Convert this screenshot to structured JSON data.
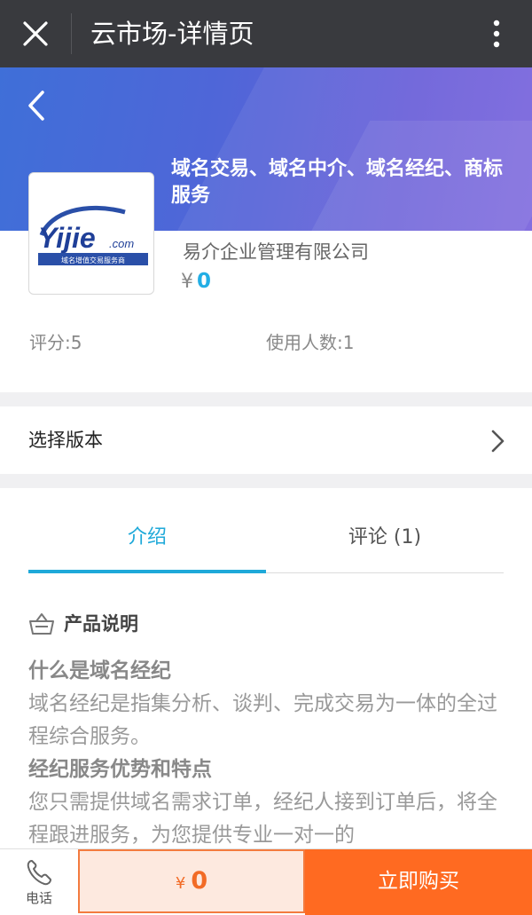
{
  "topbar": {
    "title": "云市场-详情页"
  },
  "product": {
    "name": "域名交易、域名中介、域名经纪、商标服务",
    "company": "易介企业管理有限公司",
    "currency": "¥",
    "price": "0",
    "logo_text": "Yijie.com",
    "logo_tagline": "域名增值交易服务商"
  },
  "stats": {
    "score": "评分:5",
    "users": "使用人数:1"
  },
  "version": {
    "label": "选择版本"
  },
  "tabs": [
    {
      "label": "介绍"
    },
    {
      "label": "评论 (1)"
    }
  ],
  "section": {
    "title": "产品说明"
  },
  "article": {
    "heading1": "什么是域名经纪",
    "para1": "域名经纪是指集分析、谈判、完成交易为一体的全过程综合服务。",
    "heading2": "经纪服务优势和特点",
    "para2": "您只需提供域名需求订单，经纪人接到订单后，将全程跟进服务，为您提供专业一对一的"
  },
  "bottom": {
    "phone_label": "电话",
    "currency": "¥",
    "price": "0",
    "buy_label": "立即购买"
  },
  "colors": {
    "accent": "#1fa9d9",
    "buy": "#ff6a21",
    "topbar": "#393a3e"
  }
}
